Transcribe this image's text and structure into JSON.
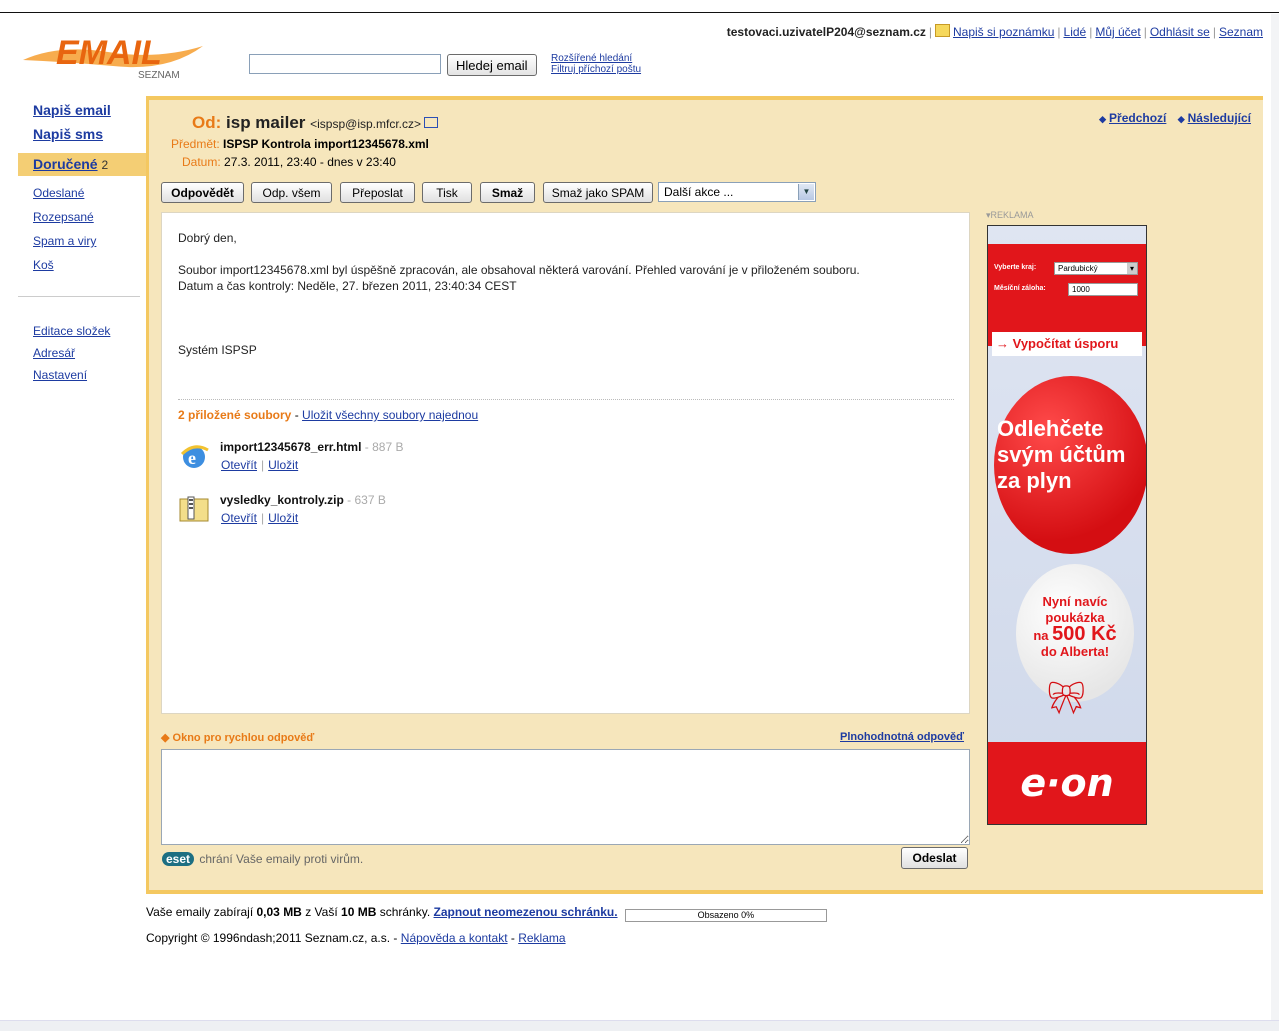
{
  "header": {
    "logo_text": "EMAIL",
    "logo_sub": "SEZNAM",
    "search_placeholder": "",
    "search_button": "Hledej email",
    "advanced_search": "Rozšířené hledání",
    "filter_mail": "Filtruj příchozí poštu",
    "user": "testovaci.uzivatelP204@seznam.cz",
    "links": [
      "Napiš si poznámku",
      "Lidé",
      "Můj účet",
      "Odhlásit se",
      "Seznam"
    ]
  },
  "sidebar": {
    "compose_email": "Napiš email",
    "compose_sms": "Napiš sms",
    "active_folder": {
      "label": "Doručené",
      "count": "2"
    },
    "folders": [
      "Odeslané",
      "Rozepsané",
      "Spam a viry",
      "Koš"
    ],
    "tools": [
      "Editace složek",
      "Adresář",
      "Nastavení"
    ]
  },
  "message": {
    "from_label": "Od:",
    "from_name": "isp mailer",
    "from_email": "<ispsp@isp.mfcr.cz>",
    "subject_label": "Předmět:",
    "subject": "ISPSP Kontrola import12345678.xml",
    "date_label": "Datum:",
    "date": "27.3. 2011, 23:40 - dnes v 23:40",
    "prev": "Předchozí",
    "next": "Následující",
    "body": [
      "Dobrý den,",
      "Soubor import12345678.xml byl úspěšně zpracován, ale obsahoval některá varování. Přehled varování je v přiloženém souboru.",
      "Datum a čas kontroly: Neděle, 27. březen 2011, 23:40:34 CEST",
      "Systém ISPSP"
    ],
    "attachments_count": "2 přiložené soubory",
    "save_all": "Uložit všechny soubory najednou",
    "attachments": [
      {
        "name": "import12345678_err.html",
        "size": "- 887 B",
        "open": "Otevřít",
        "save": "Uložit"
      },
      {
        "name": "vysledky_kontroly.zip",
        "size": "- 637 B",
        "open": "Otevřít",
        "save": "Uložit"
      }
    ]
  },
  "toolbar": {
    "reply": "Odpovědět",
    "reply_all": "Odp. všem",
    "forward": "Přeposlat",
    "print": "Tisk",
    "delete": "Smaž",
    "spam": "Smaž jako SPAM",
    "more_actions": "Další akce ..."
  },
  "quick_reply": {
    "title": "Okno pro rychlou odpověď",
    "full_reply": "Plnohodnotná odpověď",
    "value": "",
    "antivirus_brand": "eset",
    "antivirus_text": "chrání Vaše emaily proti virům.",
    "send": "Odeslat"
  },
  "ad": {
    "label": "REKLAMA",
    "region_label": "Vyberte kraj:",
    "region_value": "Pardubický",
    "deposit_label": "Měsíční záloha:",
    "deposit_value": "1000",
    "cta": "Vypočítat úsporu",
    "slogan": [
      "Odlehčete",
      "svým účtům",
      "za plyn"
    ],
    "bonus_1": "Nyní navíc",
    "bonus_2": "poukázka",
    "bonus_3a": "na",
    "bonus_3b": "500 Kč",
    "bonus_4": "do Alberta!",
    "brand": "e·on",
    "colors": {
      "brand_red": "#e1161b"
    }
  },
  "footer": {
    "usage_pre": "Vaše emaily zabírají",
    "usage_value": "0,03 MB",
    "usage_mid": "z Vaší",
    "usage_limit": "10 MB",
    "usage_post": "schránky.",
    "unlimited": "Zapnout neomezenou schránku.",
    "quota_text": "Obsazeno 0%",
    "quota_percent": 0,
    "copyright": "Copyright © 1996ndash;2011 Seznam.cz, a.s. -",
    "help": "Nápověda a kontakt",
    "ads_link": "Reklama"
  },
  "colors": {
    "accent_orange": "#e87a17",
    "panel_bg": "#f6e6bc",
    "panel_border": "#f4c860",
    "link_blue": "#1d3ba1"
  }
}
